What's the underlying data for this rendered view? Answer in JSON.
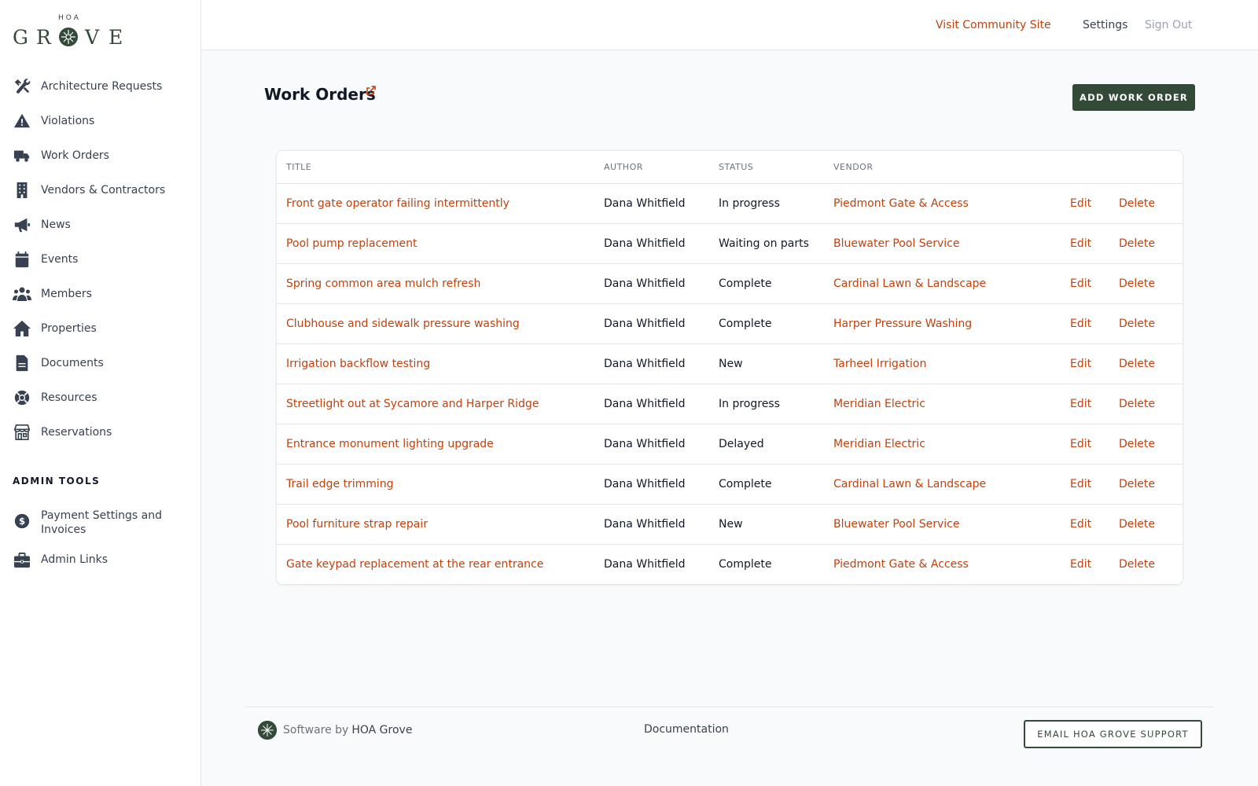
{
  "logo": {
    "top": "HOA",
    "brand": "GROVE"
  },
  "sidebar": {
    "items": [
      {
        "label": "Architecture Requests",
        "icon": "tools-icon"
      },
      {
        "label": "Violations",
        "icon": "warning-icon"
      },
      {
        "label": "Work Orders",
        "icon": "truck-icon"
      },
      {
        "label": "Vendors & Contractors",
        "icon": "building-icon"
      },
      {
        "label": "News",
        "icon": "megaphone-icon"
      },
      {
        "label": "Events",
        "icon": "calendar-icon"
      },
      {
        "label": "Members",
        "icon": "users-icon"
      },
      {
        "label": "Properties",
        "icon": "home-icon"
      },
      {
        "label": "Documents",
        "icon": "document-icon"
      },
      {
        "label": "Resources",
        "icon": "lifebuoy-icon"
      },
      {
        "label": "Reservations",
        "icon": "store-icon"
      }
    ],
    "admin_title": "ADMIN TOOLS",
    "admin_items": [
      {
        "label": "Payment Settings and Invoices",
        "icon": "dollar-icon"
      },
      {
        "label": "Admin Links",
        "icon": "briefcase-icon"
      }
    ]
  },
  "header": {
    "visit": "Visit Community Site",
    "settings": "Settings",
    "signout": "Sign Out"
  },
  "main": {
    "title": "Work Orders",
    "add_button": "ADD WORK ORDER",
    "columns": [
      "TITLE",
      "AUTHOR",
      "STATUS",
      "VENDOR"
    ],
    "edit_label": "Edit",
    "delete_label": "Delete",
    "rows": [
      {
        "title": "Front gate operator failing intermittently",
        "author": "Dana Whitfield",
        "status": "In progress",
        "vendor": "Piedmont Gate & Access"
      },
      {
        "title": "Pool pump replacement",
        "author": "Dana Whitfield",
        "status": "Waiting on parts",
        "vendor": "Bluewater Pool Service"
      },
      {
        "title": "Spring common area mulch refresh",
        "author": "Dana Whitfield",
        "status": "Complete",
        "vendor": "Cardinal Lawn & Landscape"
      },
      {
        "title": "Clubhouse and sidewalk pressure washing",
        "author": "Dana Whitfield",
        "status": "Complete",
        "vendor": "Harper Pressure Washing"
      },
      {
        "title": "Irrigation backflow testing",
        "author": "Dana Whitfield",
        "status": "New",
        "vendor": "Tarheel Irrigation"
      },
      {
        "title": "Streetlight out at Sycamore and Harper Ridge",
        "author": "Dana Whitfield",
        "status": "In progress",
        "vendor": "Meridian Electric"
      },
      {
        "title": "Entrance monument lighting upgrade",
        "author": "Dana Whitfield",
        "status": "Delayed",
        "vendor": "Meridian Electric"
      },
      {
        "title": "Trail edge trimming",
        "author": "Dana Whitfield",
        "status": "Complete",
        "vendor": "Cardinal Lawn & Landscape"
      },
      {
        "title": "Pool furniture strap repair",
        "author": "Dana Whitfield",
        "status": "New",
        "vendor": "Bluewater Pool Service"
      },
      {
        "title": "Gate keypad replacement at the rear entrance",
        "author": "Dana Whitfield",
        "status": "Complete",
        "vendor": "Piedmont Gate & Access"
      }
    ]
  },
  "footer": {
    "software_by": "Software by",
    "brand": "HOA Grove",
    "documentation": "Documentation",
    "support_button": "EMAIL HOA GROVE SUPPORT"
  },
  "colors": {
    "accent": "#c2410c",
    "brand_green": "#344a39",
    "text": "#374151",
    "muted": "#9ca3af"
  }
}
